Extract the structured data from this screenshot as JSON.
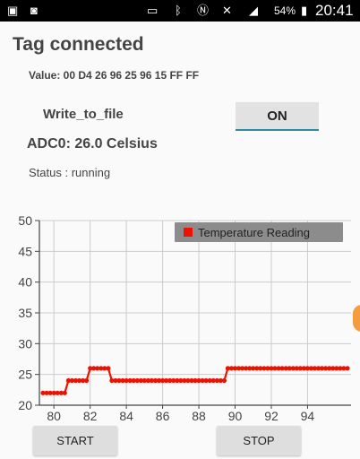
{
  "status_bar": {
    "battery": "54%",
    "time": "20:41",
    "icons": [
      "notification-icon",
      "voicemail-icon",
      "cast-icon",
      "bluetooth-icon",
      "nfc-icon",
      "mute-icon",
      "signal-icon",
      "battery-icon"
    ]
  },
  "tag": {
    "title": "Tag connected",
    "value": "Value: 00 D4 26 96 25 96 15 FF FF"
  },
  "write_to_file": {
    "label": "Write_to_file",
    "toggle_label": "ON"
  },
  "adc": "ADC0: 26.0 Celsius",
  "status": "Status : running",
  "colors": {
    "series": "#ee1100",
    "legend_bg": "#8c8c8c",
    "accent": "#2e8ba0",
    "grid": "#cccccc"
  },
  "chart_data": {
    "type": "line",
    "title": "",
    "xlabel": "",
    "ylabel": "",
    "xlim": [
      79.2,
      96.4
    ],
    "ylim": [
      20,
      50
    ],
    "x_ticks": [
      "80",
      "82",
      "84",
      "86",
      "88",
      "90",
      "92",
      "94"
    ],
    "y_ticks": [
      "20",
      "25",
      "30",
      "35",
      "40",
      "45",
      "50"
    ],
    "grid": true,
    "legend": "top-right",
    "series": [
      {
        "name": "Temperature Reading",
        "x": [
          79.4,
          79.6,
          79.8,
          80.0,
          80.2,
          80.4,
          80.6,
          80.8,
          81.0,
          81.2,
          81.4,
          81.6,
          81.8,
          82.0,
          82.2,
          82.4,
          82.6,
          82.8,
          83.0,
          83.2,
          83.4,
          83.6,
          83.8,
          84.0,
          84.2,
          84.4,
          84.6,
          84.8,
          85.0,
          85.2,
          85.4,
          85.6,
          85.8,
          86.0,
          86.2,
          86.4,
          86.6,
          86.8,
          87.0,
          87.2,
          87.4,
          87.6,
          87.8,
          88.0,
          88.2,
          88.4,
          88.6,
          88.8,
          89.0,
          89.2,
          89.4,
          89.6,
          89.8,
          90.0,
          90.2,
          90.4,
          90.6,
          90.8,
          91.0,
          91.2,
          91.4,
          91.6,
          91.8,
          92.0,
          92.2,
          92.4,
          92.6,
          92.8,
          93.0,
          93.2,
          93.4,
          93.6,
          93.8,
          94.0,
          94.2,
          94.4,
          94.6,
          94.8,
          95.0,
          95.2,
          95.4,
          95.6,
          95.8,
          96.0,
          96.2
        ],
        "y": [
          22,
          22,
          22,
          22,
          22,
          22,
          22,
          24,
          24,
          24,
          24,
          24,
          24,
          26,
          26,
          26,
          26,
          26,
          26,
          24,
          24,
          24,
          24,
          24,
          24,
          24,
          24,
          24,
          24,
          24,
          24,
          24,
          24,
          24,
          24,
          24,
          24,
          24,
          24,
          24,
          24,
          24,
          24,
          24,
          24,
          24,
          24,
          24,
          24,
          24,
          24,
          26,
          26,
          26,
          26,
          26,
          26,
          26,
          26,
          26,
          26,
          26,
          26,
          26,
          26,
          26,
          26,
          26,
          26,
          26,
          26,
          26,
          26,
          26,
          26,
          26,
          26,
          26,
          26,
          26,
          26,
          26,
          26,
          26,
          26
        ]
      }
    ]
  },
  "buttons": {
    "start": "START",
    "stop": "STOP"
  }
}
